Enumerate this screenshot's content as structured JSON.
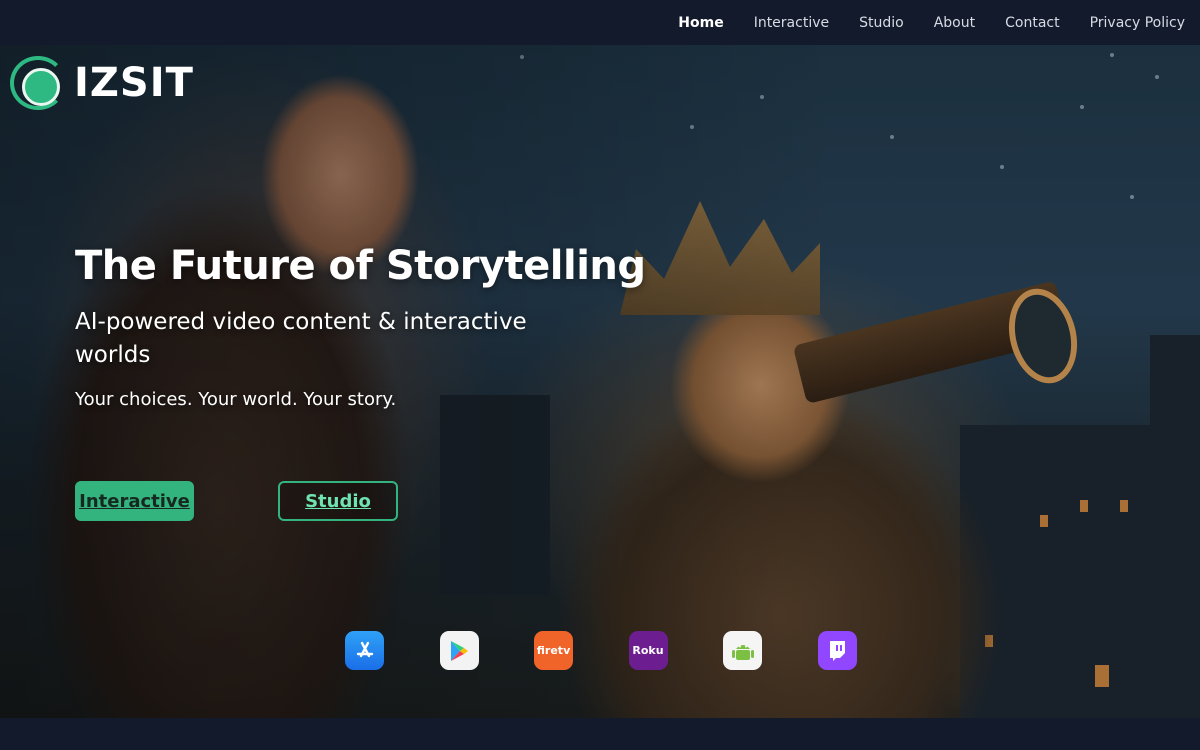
{
  "brand": {
    "name": "IZSIT",
    "logo_icon": "ring-logo-icon",
    "accent": "#33b37e"
  },
  "nav": {
    "items": [
      {
        "label": "Home",
        "active": true
      },
      {
        "label": "Interactive"
      },
      {
        "label": "Studio"
      },
      {
        "label": "About"
      },
      {
        "label": "Contact"
      },
      {
        "label": "Privacy Policy"
      }
    ]
  },
  "hero": {
    "title": "The Future of Storytelling",
    "subtitle": "AI-powered video content & interactive worlds",
    "tagline": "Your choices. Your world. Your story.",
    "buttons": {
      "primary": "Interactive",
      "secondary": "Studio"
    },
    "background_image": "elf-and-goblin-with-telescope"
  },
  "platforms": [
    {
      "name": "app-store-icon"
    },
    {
      "name": "google-play-icon"
    },
    {
      "name": "fire-tv-icon",
      "label": "firetv"
    },
    {
      "name": "roku-icon",
      "label": "Roku"
    },
    {
      "name": "android-icon"
    },
    {
      "name": "twitch-icon"
    }
  ],
  "colors": {
    "topbar": "#121a2c",
    "accent": "#33b37e",
    "text": "#ffffff"
  }
}
